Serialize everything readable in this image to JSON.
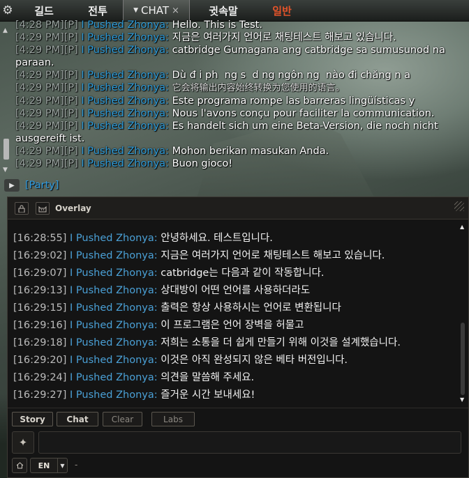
{
  "top_tabs": {
    "settings_icon": "gear-icon",
    "guild": "길드",
    "battle": "전투",
    "chat": "CHAT",
    "chat_close": "×",
    "whisper": "귓속말",
    "general": "일반"
  },
  "game_log": {
    "lines": [
      {
        "time": "[4:28 PM]",
        "ch": "[P]",
        "name": "I Pushed Zhonya:",
        "msg": "Hello. This is Test."
      },
      {
        "time": "[4:29 PM]",
        "ch": "[P]",
        "name": "I Pushed Zhonya:",
        "msg": "지금은 여러가지 언어로 채팅테스트 해보고 있습니다."
      },
      {
        "time": "[4:29 PM]",
        "ch": "[P]",
        "name": "I Pushed Zhonya:",
        "msg": "catbridge Gumagana ang catbridge sa sumusunod na paraan."
      },
      {
        "time": "[4:29 PM]",
        "ch": "[P]",
        "name": "I Pushed Zhonya:",
        "msg": "Dù đ i ph  ng s  d ng ngôn ng  nào đi chăng n a"
      },
      {
        "time": "[4:29 PM]",
        "ch": "[P]",
        "name": "I Pushed Zhonya:",
        "msg": "它会将输出内容始终转换为您使用的语言。"
      },
      {
        "time": "[4:29 PM]",
        "ch": "[P]",
        "name": "I Pushed Zhonya:",
        "msg": "Este programa rompe las barreras lingüísticas y"
      },
      {
        "time": "[4:29 PM]",
        "ch": "[P]",
        "name": "I Pushed Zhonya:",
        "msg": "Nous l'avons conçu pour faciliter la communication."
      },
      {
        "time": "[4:29 PM]",
        "ch": "[P]",
        "name": "I Pushed Zhonya:",
        "msg": "Es handelt sich um eine Beta-Version, die noch nicht ausgereift ist."
      },
      {
        "time": "[4:29 PM]",
        "ch": "[P]",
        "name": "I Pushed Zhonya:",
        "msg": "Mohon berikan masukan Anda."
      },
      {
        "time": "[4:29 PM]",
        "ch": "[P]",
        "name": "I Pushed Zhonya:",
        "msg": "Buon gioco!"
      }
    ],
    "party_label": "[Party]"
  },
  "overlay": {
    "title": "Overlay",
    "messages": [
      {
        "time": "[16:28:55]",
        "name": "I Pushed Zhonya:",
        "msg": "안녕하세요. 테스트입니다."
      },
      {
        "time": "[16:29:02]",
        "name": "I Pushed Zhonya:",
        "msg": "지금은 여러가지 언어로 채팅테스트 해보고 있습니다."
      },
      {
        "time": "[16:29:07]",
        "name": "I Pushed Zhonya:",
        "msg": "catbridge는 다음과 같이 작동합니다."
      },
      {
        "time": "[16:29:13]",
        "name": "I Pushed Zhonya:",
        "msg": "상대방이 어떤 언어를 사용하더라도"
      },
      {
        "time": "[16:29:15]",
        "name": "I Pushed Zhonya:",
        "msg": "출력은 항상 사용하시는 언어로 변환됩니다"
      },
      {
        "time": "[16:29:16]",
        "name": "I Pushed Zhonya:",
        "msg": "이 프로그램은 언어 장벽을 허물고"
      },
      {
        "time": "[16:29:18]",
        "name": "I Pushed Zhonya:",
        "msg": "저희는 소통을 더 쉽게 만들기 위해 이것을 설계했습니다."
      },
      {
        "time": "[16:29:20]",
        "name": "I Pushed Zhonya:",
        "msg": "이것은 아직 완성되지 않은 베타 버전입니다."
      },
      {
        "time": "[16:29:24]",
        "name": "I Pushed Zhonya:",
        "msg": "의견을 말씀해 주세요."
      },
      {
        "time": "[16:29:27]",
        "name": "I Pushed Zhonya:",
        "msg": "즐거운 시간 보내세요!"
      }
    ],
    "buttons": {
      "story": "Story",
      "chat": "Chat",
      "clear": "Clear",
      "labs": "Labs"
    },
    "input": {
      "value": "",
      "placeholder": ""
    },
    "language": "EN",
    "status_text": "-"
  },
  "colors": {
    "name_blue": "#4aa0d6",
    "general_tab_red": "#e2532a",
    "party_blue": "#2f9be0"
  }
}
